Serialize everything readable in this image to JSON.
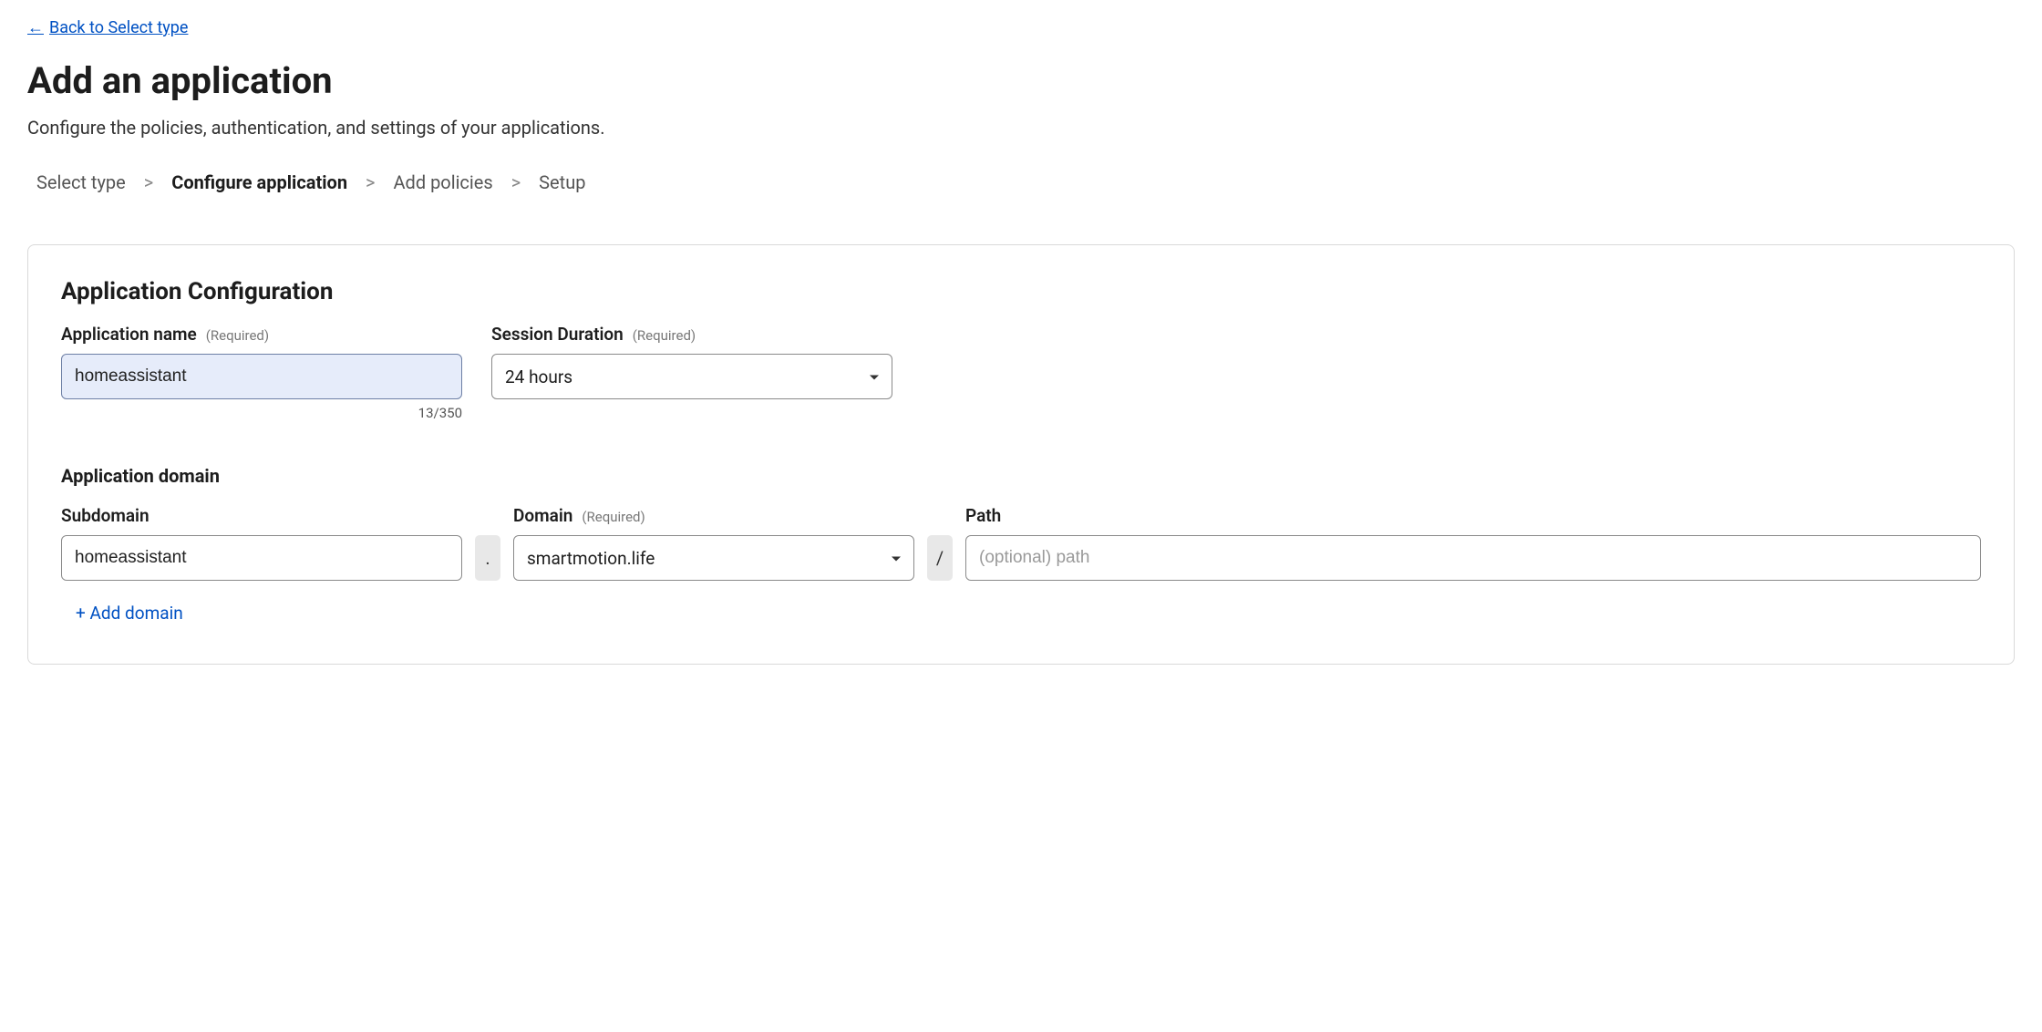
{
  "back_link": {
    "label": "Back to Select type"
  },
  "page": {
    "title": "Add an application",
    "subtitle": "Configure the policies, authentication, and settings of your applications."
  },
  "breadcrumb": {
    "steps": [
      "Select type",
      "Configure application",
      "Add policies",
      "Setup"
    ],
    "active_index": 1,
    "separator": ">"
  },
  "config": {
    "section_title": "Application Configuration",
    "app_name": {
      "label": "Application name",
      "required_tag": "(Required)",
      "value": "homeassistant",
      "counter": "13/350"
    },
    "session": {
      "label": "Session Duration",
      "required_tag": "(Required)",
      "value": "24 hours"
    },
    "domain_section_title": "Application domain",
    "subdomain": {
      "label": "Subdomain",
      "value": "homeassistant"
    },
    "domain": {
      "label": "Domain",
      "required_tag": "(Required)",
      "value": "smartmotion.life"
    },
    "path": {
      "label": "Path",
      "placeholder": "(optional) path",
      "value": ""
    },
    "connectors": {
      "dot": ".",
      "slash": "/"
    },
    "add_domain_label": "+ Add domain"
  }
}
